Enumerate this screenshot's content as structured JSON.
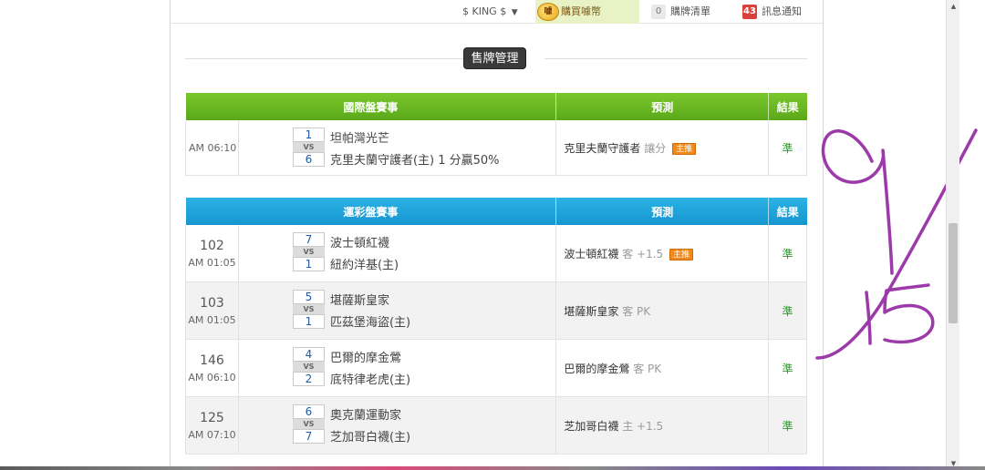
{
  "topnav": {
    "user_label": "$ KING $",
    "buy_coin_label": "購買噱幣",
    "coin_badge": "噱",
    "cart_count": "0",
    "cart_label": "購牌清單",
    "notify_count": "43",
    "notify_label": "訊息通知"
  },
  "section": {
    "sell_button": "售牌管理"
  },
  "international": {
    "headers": [
      "國際盤賽事",
      "預測",
      "結果"
    ],
    "rows": [
      {
        "time": "AM 06:10",
        "score_top": "1",
        "vs": "VS",
        "score_bot": "6",
        "team_top": "坦帕灣光芒",
        "team_bot": "克里夫蘭守護者(主) 1 分贏50%",
        "pick": "克里夫蘭守護者",
        "pick_detail": "讓分",
        "badge": "主推",
        "result": "準"
      }
    ]
  },
  "lottery": {
    "headers": [
      "運彩盤賽事",
      "預測",
      "結果"
    ],
    "rows": [
      {
        "num": "102",
        "time": "AM 01:05",
        "score_top": "7",
        "vs": "VS",
        "score_bot": "1",
        "team_top": "波士頓紅襪",
        "team_bot": "紐約洋基(主)",
        "pick": "波士頓紅襪",
        "pick_detail": "客 +1.5",
        "badge": "主推",
        "result": "準"
      },
      {
        "num": "103",
        "time": "AM 01:05",
        "score_top": "5",
        "vs": "VS",
        "score_bot": "1",
        "team_top": "堪薩斯皇家",
        "team_bot": "匹茲堡海盜(主)",
        "pick": "堪薩斯皇家",
        "pick_detail": "客 PK",
        "result": "準"
      },
      {
        "num": "146",
        "time": "AM 06:10",
        "score_top": "4",
        "vs": "VS",
        "score_bot": "2",
        "team_top": "巴爾的摩金鶯",
        "team_bot": "底特律老虎(主)",
        "pick": "巴爾的摩金鶯",
        "pick_detail": "客 PK",
        "result": "準"
      },
      {
        "num": "125",
        "time": "AM 07:10",
        "score_top": "6",
        "vs": "VS",
        "score_bot": "7",
        "team_top": "奧克蘭運動家",
        "team_bot": "芝加哥白襪(主)",
        "pick": "芝加哥白襪",
        "pick_detail": "主 +1.5",
        "result": "準"
      }
    ]
  },
  "colors": {
    "intl_header": "#5aa81a",
    "lottery_header": "#1596cf",
    "result_green": "#2b9a2b",
    "badge_orange": "#f08a1c",
    "handwriting": "#9b3aa8"
  },
  "scrollbar": {
    "up_icon": "▲",
    "down_icon": "▼"
  }
}
